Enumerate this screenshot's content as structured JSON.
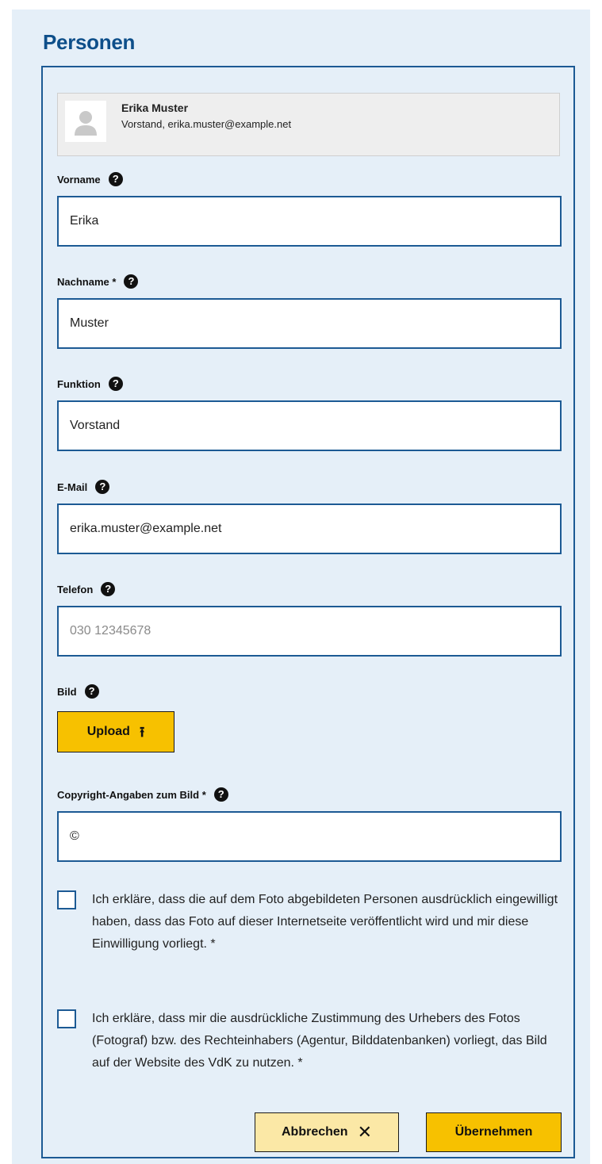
{
  "section": {
    "title": "Personen"
  },
  "summary": {
    "name": "Erika Muster",
    "subtitle": "Vorstand, erika.muster@example.net",
    "avatar_icon": "user-avatar-icon"
  },
  "fields": {
    "vorname": {
      "label": "Vorname",
      "value": "Erika",
      "placeholder": ""
    },
    "nachname": {
      "label": "Nachname *",
      "value": "Muster",
      "placeholder": ""
    },
    "funktion": {
      "label": "Funktion",
      "value": "Vorstand",
      "placeholder": ""
    },
    "email": {
      "label": "E-Mail",
      "value": "erika.muster@example.net",
      "placeholder": ""
    },
    "telefon": {
      "label": "Telefon",
      "value": "",
      "placeholder": "030 12345678"
    },
    "bild": {
      "label": "Bild",
      "button_label": "Upload",
      "button_icon": "upload-arrow-icon"
    },
    "copyright": {
      "label": "Copyright-Angaben zum Bild *",
      "value": "©",
      "placeholder": ""
    }
  },
  "help_glyph": "?",
  "consents": [
    {
      "text": "Ich erkläre, dass die auf dem Foto abgebildeten Personen ausdrücklich eingewilligt haben, dass das Foto auf dieser Internetseite veröffentlicht wird und mir diese Einwilligung vorliegt. *",
      "checked": false
    },
    {
      "text": "Ich erkläre, dass mir die ausdrückliche Zustimmung des Urhebers des Fotos (Fotograf) bzw. des Rechteinhabers (Agentur, Bilddatenbanken) vorliegt, das Bild auf der Website des VdK zu nutzen. *",
      "checked": false
    }
  ],
  "actions": {
    "cancel_label": "Abbrechen",
    "cancel_icon": "close-icon",
    "apply_label": "Übernehmen"
  },
  "colors": {
    "section_background": "#e5eff8",
    "primary_blue": "#1c5a94",
    "title_blue": "#0e4f8a",
    "accent_yellow": "#f7c100",
    "light_yellow": "#fbe8a6"
  }
}
